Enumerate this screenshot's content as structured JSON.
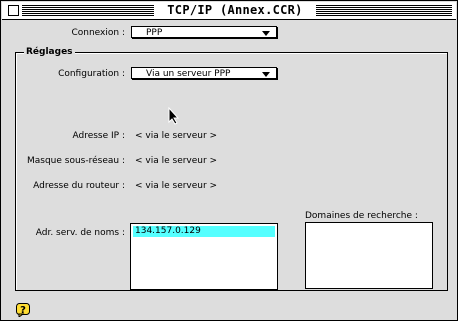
{
  "window": {
    "title": "TCP/IP (Annex.CCR)",
    "close_icon": "close-box-icon"
  },
  "connexion": {
    "label": "Connexion :",
    "value": "PPP"
  },
  "reglages": {
    "title": "Réglages",
    "configuration": {
      "label": "Configuration :",
      "value": "Via un serveur PPP"
    },
    "adresse_ip": {
      "label": "Adresse IP :",
      "value": "< via le serveur >"
    },
    "masque": {
      "label": "Masque sous-réseau :",
      "value": "< via le serveur >"
    },
    "routeur": {
      "label": "Adresse du routeur :",
      "value": "< via le serveur >"
    },
    "dns": {
      "label": "Adr. serv. de noms :",
      "entries": [
        "134.157.0.129"
      ]
    },
    "domaines": {
      "label": "Domaines de recherche :",
      "entries": []
    }
  },
  "icons": {
    "help": "help-icon",
    "cursor": "arrow-cursor-icon"
  },
  "colors": {
    "window_bg": "#dddddd",
    "selection": "#55ffff"
  }
}
